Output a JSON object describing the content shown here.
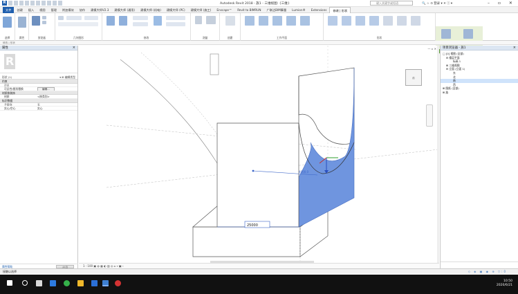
{
  "window": {
    "title": "Autodesk Revit 2018 -   族1 - 三维视图: {三维}",
    "search_placeholder": "键入关键字或短语",
    "sign_in": "登录"
  },
  "ribbon": {
    "tabs": [
      "文件",
      "创建",
      "插入",
      "视图",
      "管理",
      "附加模块",
      "协作",
      "建模大师V2.3",
      "建模大师 (通用)",
      "建模大师 (机电)",
      "建模大师 (PC)",
      "建模大师 (施工)",
      "Enscape™",
      "Revit to BIMRUN",
      "广联达BIM算量",
      "Lumion®",
      "Extensions",
      "修改 | 形状"
    ],
    "active_tab": "修改 | 形状",
    "groups": [
      "选择",
      "属性",
      "剪贴板",
      "几何图形",
      "修改",
      "测量",
      "创建",
      "工作平面",
      "形状",
      "在编辑"
    ],
    "contextual_group": "形状图元",
    "footer": "修改 | 形状"
  },
  "properties": {
    "title": "属性",
    "selector_value": "形状 (1)",
    "edit_type_label": "编辑类型",
    "rows": [
      {
        "cat": "约束"
      },
      {
        "k": "可见",
        "v": ""
      },
      {
        "k": "可见性/图形替换",
        "v": "编辑..."
      },
      {
        "cat": "材质和装饰"
      },
      {
        "k": "材质",
        "v": "<按类别>"
      },
      {
        "cat": "标识数据"
      },
      {
        "k": "子类别",
        "v": "无"
      },
      {
        "k": "实心/空心",
        "v": "实心"
      }
    ],
    "help_link": "属性帮助",
    "apply_label": "应用"
  },
  "viewport": {
    "dimension_value": "25000",
    "scale_label": "1 : 100",
    "temp_dim_top": "4000.0",
    "colors": {
      "face": "#6f95df",
      "face_stroke": "#4a6fc0",
      "line": "#555555",
      "dim": "#3a64c8"
    }
  },
  "browser": {
    "title": "项目浏览器 - 族1",
    "nodes": [
      {
        "label": "□ [0] 视图 (全部)",
        "indent": 0
      },
      {
        "label": "⊟ 楼层平面",
        "indent": 1
      },
      {
        "label": "标高 1",
        "indent": 3
      },
      {
        "label": "⊞ 三维视图",
        "indent": 1
      },
      {
        "label": "⊟ 立面 (立面 1)",
        "indent": 1
      },
      {
        "label": "东",
        "indent": 3
      },
      {
        "label": "北",
        "indent": 3
      },
      {
        "label": "南",
        "indent": 3,
        "selected": true
      },
      {
        "label": "西",
        "indent": 3
      },
      {
        "label": "⊞ 图纸 (全部)",
        "indent": 0
      },
      {
        "label": "⊞ 族",
        "indent": 0
      }
    ]
  },
  "statusbar": {
    "text": "接触以选择",
    "tray": "▽:0"
  },
  "taskbar": {
    "time": "10:50",
    "date": "2020/6/21"
  }
}
